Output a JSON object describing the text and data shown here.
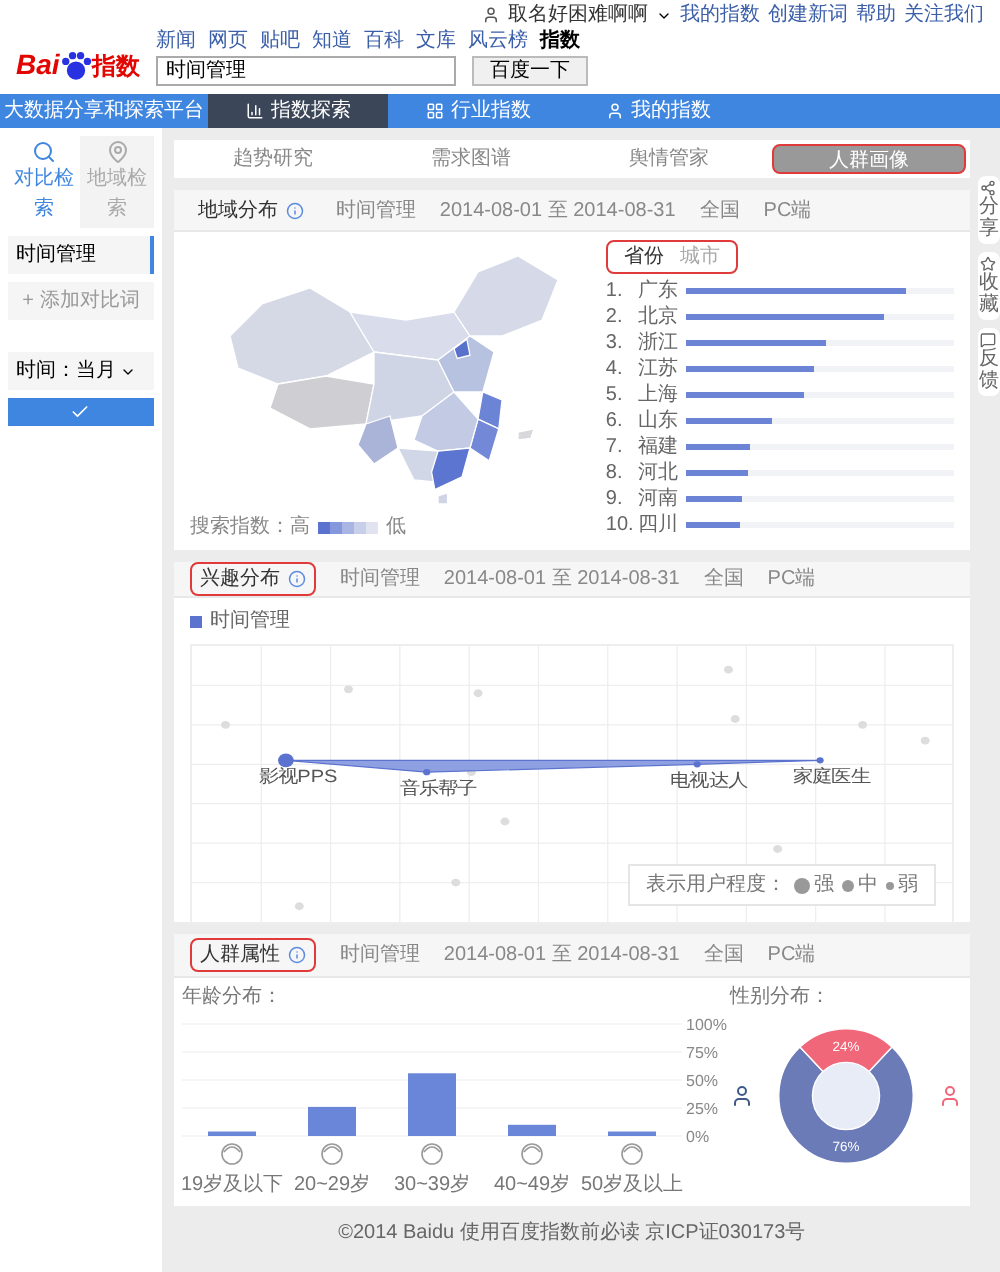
{
  "header": {
    "logo": [
      "Bai",
      "指数"
    ],
    "nav": [
      {
        "label": "新闻",
        "selected": false
      },
      {
        "label": "网页",
        "selected": false
      },
      {
        "label": "贴吧",
        "selected": false
      },
      {
        "label": "知道",
        "selected": false
      },
      {
        "label": "百科",
        "selected": false
      },
      {
        "label": "文库",
        "selected": false
      },
      {
        "label": "风云榜",
        "selected": false
      },
      {
        "label": "指数",
        "selected": true
      }
    ],
    "search": {
      "value": "时间管理"
    },
    "search_button": "百度一下",
    "user": "取名好困难啊啊",
    "links": [
      "我的指数",
      "创建新词",
      "帮助",
      "关注我们"
    ]
  },
  "main_nav": {
    "slogan": "大数据分享和探索平台",
    "items": [
      {
        "label": "指数探索",
        "selected": true
      },
      {
        "label": "行业指数",
        "selected": false
      },
      {
        "label": "我的指数",
        "selected": false
      }
    ]
  },
  "sidebar": {
    "modes": [
      {
        "label": "对比检索",
        "selected": true
      },
      {
        "label": "地域检索",
        "selected": false
      }
    ],
    "keywords": [
      "时间管理"
    ],
    "add_button": "+ 添加对比词",
    "time_select": "时间：当月"
  },
  "tabs": [
    {
      "label": "趋势研究",
      "selected": false
    },
    {
      "label": "需求图谱",
      "selected": false
    },
    {
      "label": "舆情管家",
      "selected": false
    },
    {
      "label": "人群画像",
      "selected": true
    }
  ],
  "side_tools": [
    "分享",
    "收藏",
    "反馈"
  ],
  "region_card": {
    "title": "地域分布",
    "keyword": "时间管理",
    "date_range": "2014-08-01 至 2014-08-31",
    "scope": "全国",
    "device": "PC端",
    "toggles": [
      {
        "label": "省份",
        "selected": true
      },
      {
        "label": "城市",
        "selected": false
      }
    ],
    "ranking": [
      {
        "rank": "1.",
        "name": "广东",
        "level": 0.82
      },
      {
        "rank": "2.",
        "name": "北京",
        "level": 0.74
      },
      {
        "rank": "3.",
        "name": "浙江",
        "level": 0.52
      },
      {
        "rank": "4.",
        "name": "江苏",
        "level": 0.48
      },
      {
        "rank": "5.",
        "name": "上海",
        "level": 0.44
      },
      {
        "rank": "6.",
        "name": "山东",
        "level": 0.32
      },
      {
        "rank": "7.",
        "name": "福建",
        "level": 0.24
      },
      {
        "rank": "8.",
        "name": "河北",
        "level": 0.23
      },
      {
        "rank": "9.",
        "name": "河南",
        "level": 0.21
      },
      {
        "rank": "10.",
        "name": "四川",
        "level": 0.2
      }
    ],
    "legend": {
      "label": "搜索指数：高",
      "low": "低"
    }
  },
  "interest_card": {
    "title": "兴趣分布",
    "keyword": "时间管理",
    "date_range": "2014-08-01 至 2014-08-31",
    "scope": "全国",
    "device": "PC端",
    "series": "时间管理",
    "nodes": [
      "影视PPS",
      "音乐帮子",
      "电视达人",
      "家庭医生"
    ],
    "legend": {
      "label": "表示用户程度：",
      "levels": [
        "强",
        "中",
        "弱"
      ]
    }
  },
  "people_card": {
    "title": "人群属性",
    "keyword": "时间管理",
    "date_range": "2014-08-01 至 2014-08-31",
    "scope": "全国",
    "device": "PC端",
    "age": {
      "label": "年龄分布：",
      "chart_data": {
        "type": "bar",
        "grid": true,
        "categories": [
          "19岁及以下",
          "20~29岁",
          "30~39岁",
          "40~49岁",
          "50岁及以上"
        ],
        "series": [
          {
            "color": "#6a86d8",
            "values": [
              4,
              26,
              56,
              10,
              4
            ]
          }
        ],
        "ylim": [
          0,
          100
        ],
        "yticks": [
          {
            "value": 0,
            "label": "0%"
          },
          {
            "value": 25,
            "label": "25%"
          },
          {
            "value": 50,
            "label": "50%"
          },
          {
            "value": 75,
            "label": "75%"
          },
          {
            "value": 100,
            "label": "100%"
          }
        ]
      }
    },
    "gender": {
      "label": "性别分布：",
      "chart_data": {
        "type": "donut",
        "series": [
          {
            "values": [
              76,
              24
            ]
          }
        ],
        "colors": [
          "#6b7bb8",
          "#f0677a"
        ],
        "value_labels": [
          "76%",
          "24%"
        ]
      }
    }
  },
  "footer": "©2014 Baidu 使用百度指数前必读 京ICP证030173号"
}
